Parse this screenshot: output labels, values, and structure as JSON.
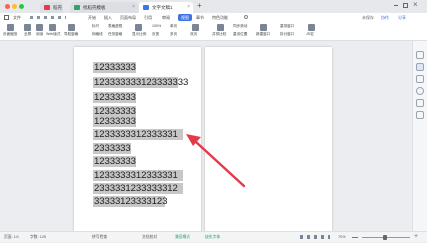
{
  "window": {
    "tabs": [
      {
        "label": "稻壳"
      },
      {
        "label": "找稻壳模板"
      },
      {
        "label": "文字文稿1"
      }
    ],
    "add_tab": "+",
    "close_glyph": "×"
  },
  "menu": {
    "file_label": "文件",
    "items": [
      "开始",
      "插入",
      "页面布局",
      "引用",
      "审阅",
      "视图",
      "章节",
      "特色功能"
    ],
    "active_index": 5,
    "right_items": [
      "未保存",
      "协作",
      "分享"
    ]
  },
  "ribbon": {
    "labels": [
      "页面缩放",
      "全屏",
      "阅读",
      "写作模式",
      "Web版式",
      "导航窗格",
      "标尺",
      "网格线",
      "表格虚框",
      "任务窗格",
      "显示比例",
      "100%",
      "页宽",
      "单页",
      "多页",
      "双页",
      "并排比较",
      "同步滚动",
      "重设位置",
      "新建窗口",
      "重排窗口",
      "拆分窗口",
      "JS宏"
    ]
  },
  "document": {
    "lines": [
      "12333333",
      "123333333123333333",
      "12333333",
      "12333333",
      "12333333",
      "1233333312333331",
      "2333333",
      "12333333",
      "1233333312333331",
      "2333331233333312",
      "33333123333123"
    ]
  },
  "status": {
    "page": "页面: 1/1",
    "words": "字数: 125",
    "spell": "拼写检查",
    "doc_check": "文档校对",
    "compat": "兼容模式",
    "missing_font": "缺失字体",
    "zoom": "70%"
  },
  "colors": {
    "accent": "#3f73e6",
    "highlight": "#c7c7c7",
    "arrow": "#e5394a"
  }
}
